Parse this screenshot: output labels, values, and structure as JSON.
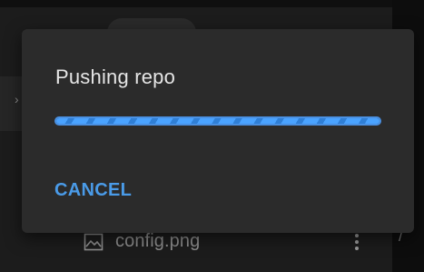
{
  "dialog": {
    "title": "Pushing repo",
    "progress_percent": 100,
    "cancel_label": "CANCEL"
  },
  "background": {
    "file_row": {
      "file_name": "config.png",
      "icon": "image-icon",
      "menu_icon": "kebab-menu-icon"
    },
    "chevron_glyph": "›",
    "edge_glyph": "/"
  },
  "colors": {
    "accent": "#4a9be8",
    "dialog_bg": "#2b2b2b",
    "title_text": "#e6e6e6"
  }
}
